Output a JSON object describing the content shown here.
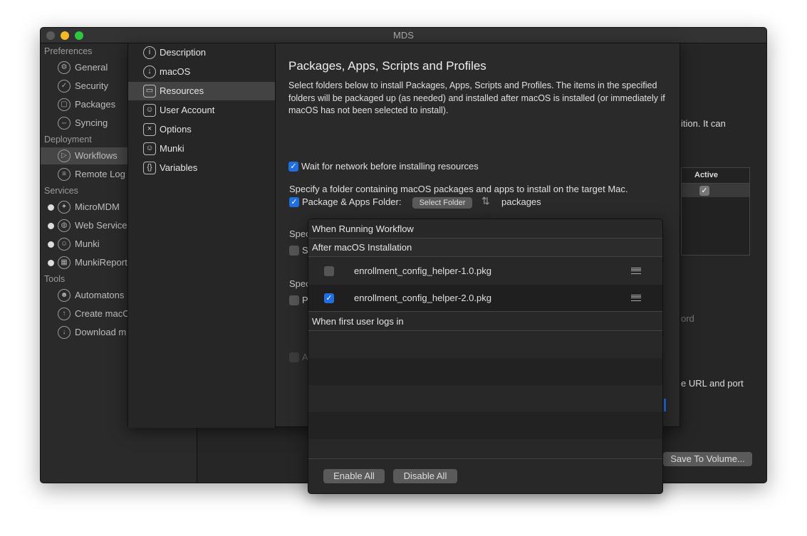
{
  "window": {
    "title": "MDS"
  },
  "sidebar": {
    "sections": [
      {
        "label": "Preferences",
        "items": [
          {
            "label": "General",
            "icon": "gear-icon"
          },
          {
            "label": "Security",
            "icon": "shield-check-icon"
          },
          {
            "label": "Packages",
            "icon": "box-icon"
          },
          {
            "label": "Syncing",
            "icon": "sync-icon"
          }
        ]
      },
      {
        "label": "Deployment",
        "items": [
          {
            "label": "Workflows",
            "icon": "play-icon",
            "selected": true
          },
          {
            "label": "Remote Log",
            "icon": "message-icon"
          }
        ]
      },
      {
        "label": "Services",
        "items": [
          {
            "label": "MicroMDM",
            "icon": "micromdm-icon"
          },
          {
            "label": "Web Service",
            "icon": "globe-icon"
          },
          {
            "label": "Munki",
            "icon": "munki-icon"
          },
          {
            "label": "MunkiReport",
            "icon": "munkireport-icon"
          }
        ]
      },
      {
        "label": "Tools",
        "items": [
          {
            "label": "Automatons",
            "icon": "robot-icon"
          },
          {
            "label": "Create macOS",
            "icon": "upload-icon"
          },
          {
            "label": "Download m",
            "icon": "download-icon"
          }
        ]
      }
    ]
  },
  "background": {
    "text1": "ition. It can",
    "table_header": "Active",
    "text2": "ord",
    "text3": "e URL and port",
    "save_button": "Save To Volume..."
  },
  "sheet": {
    "items": [
      {
        "label": "Description",
        "icon": "info-icon"
      },
      {
        "label": "macOS",
        "icon": "macos-install-icon"
      },
      {
        "label": "Resources",
        "icon": "briefcase-icon",
        "selected": true
      },
      {
        "label": "User Account",
        "icon": "user-icon"
      },
      {
        "label": "Options",
        "icon": "options-icon"
      },
      {
        "label": "Munki",
        "icon": "munki-icon"
      },
      {
        "label": "Variables",
        "icon": "braces-icon"
      }
    ],
    "title": "Packages, Apps, Scripts and Profiles",
    "description": "Select folders below to install Packages, Apps, Scripts and Profiles. The items in the specified folders will be packaged up (as needed) and installed after macOS is installed (or immediately if macOS has not been selected to install).",
    "wait_network": {
      "label": "Wait for network before installing resources",
      "checked": true
    },
    "pkg_desc": "Specify a folder containing macOS packages and apps to install on the target Mac.",
    "pkg_folder": {
      "label": "Package & Apps Folder:",
      "checked": true,
      "button": "Select Folder",
      "value": "packages"
    },
    "partial": [
      "Spec",
      "S",
      "Spec",
      "P",
      "A"
    ]
  },
  "popover": {
    "title": "When Running Workflow",
    "section1": "After macOS Installation",
    "packages": [
      {
        "name": "enrollment_config_helper-1.0.pkg",
        "checked": false
      },
      {
        "name": "enrollment_config_helper-2.0.pkg",
        "checked": true
      }
    ],
    "section2": "When first user logs in",
    "enable_all": "Enable All",
    "disable_all": "Disable All"
  },
  "colors": {
    "accent": "#1f6fe0",
    "background": "#262626"
  }
}
